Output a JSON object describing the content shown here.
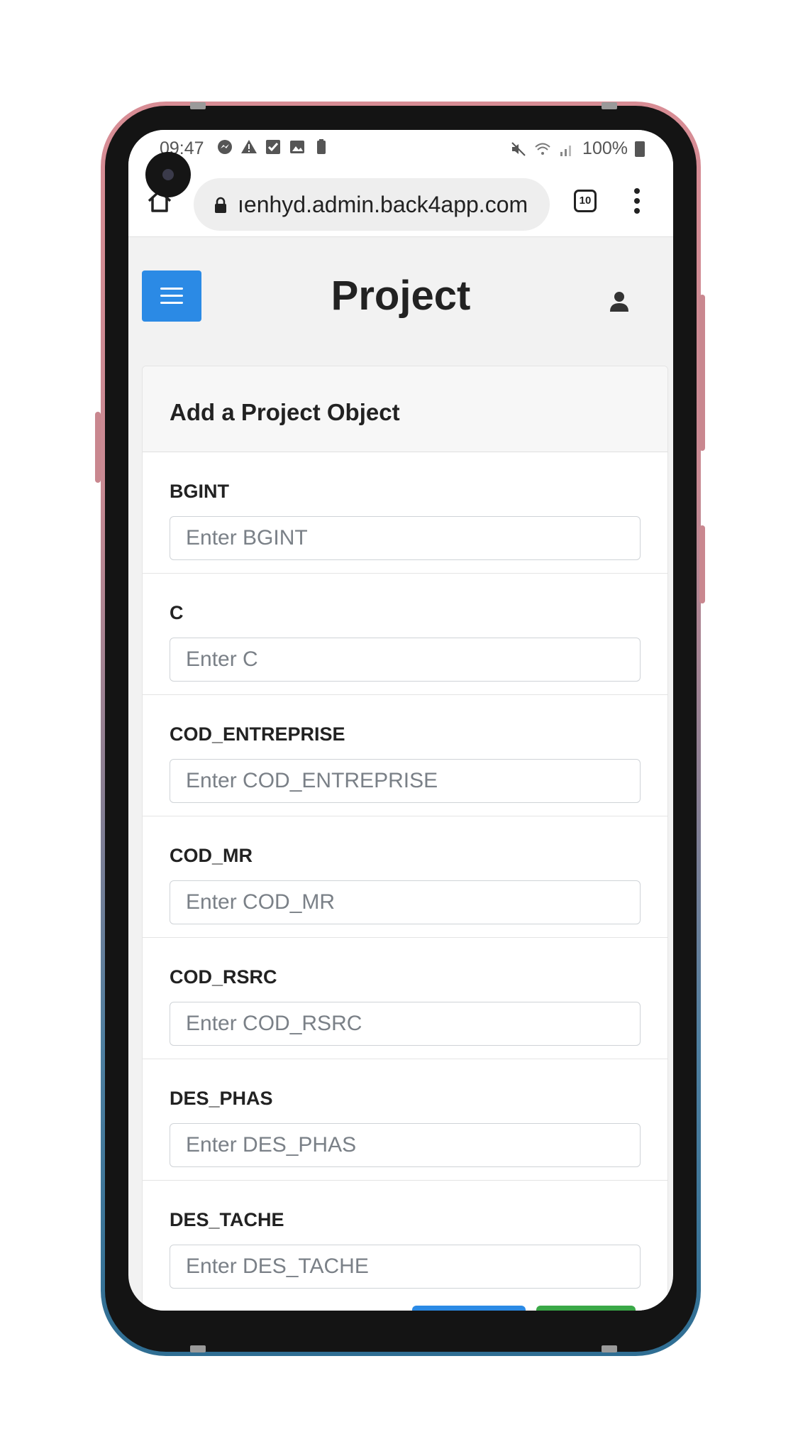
{
  "status_bar": {
    "time": "09:47",
    "battery": "100%"
  },
  "browser": {
    "url": "ıenhyd.admin.back4app.com",
    "tab_count": "10"
  },
  "header": {
    "title": "Project"
  },
  "card": {
    "title": "Add a Project Object",
    "fields": [
      {
        "label": "BGINT",
        "placeholder": "Enter BGINT"
      },
      {
        "label": "C",
        "placeholder": "Enter C"
      },
      {
        "label": "COD_ENTREPRISE",
        "placeholder": "Enter COD_ENTREPRISE"
      },
      {
        "label": "COD_MR",
        "placeholder": "Enter COD_MR"
      },
      {
        "label": "COD_RSRC",
        "placeholder": "Enter COD_RSRC"
      },
      {
        "label": "DES_PHAS",
        "placeholder": "Enter DES_PHAS"
      },
      {
        "label": "DES_TACHE",
        "placeholder": "Enter DES_TACHE"
      }
    ]
  },
  "colors": {
    "primary": "#2b8ae5",
    "success": "#3aa847"
  },
  "icons": [
    "home-icon",
    "lock-icon",
    "tabs-icon",
    "menu-dots-icon",
    "hamburger-icon",
    "user-icon"
  ]
}
